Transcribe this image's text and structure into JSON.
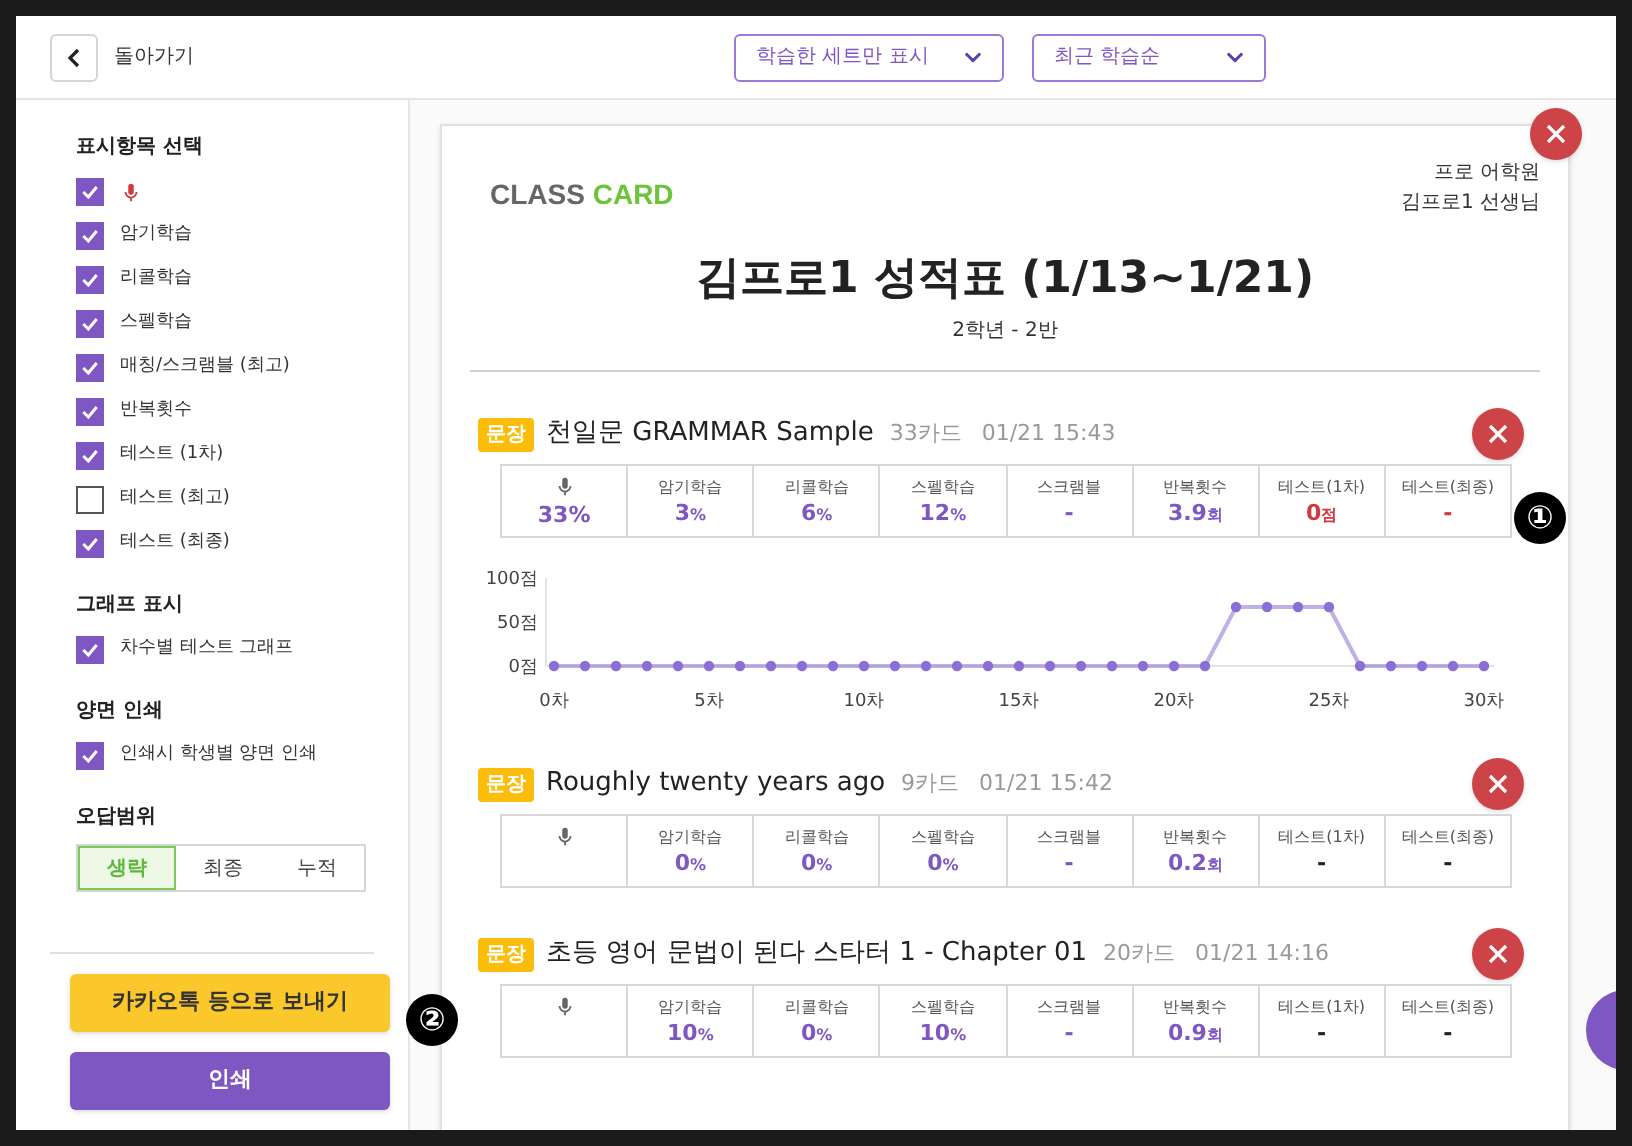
{
  "header": {
    "back_label": "돌아가기",
    "filters": [
      {
        "value": "학습한 세트만 표시"
      },
      {
        "value": "최근 학습순"
      }
    ]
  },
  "sidebar": {
    "sections": [
      {
        "title": "표시항목 선택",
        "items": [
          {
            "kind": "mic",
            "checked": true
          },
          {
            "kind": "text",
            "label": "암기학습",
            "checked": true
          },
          {
            "kind": "text",
            "label": "리콜학습",
            "checked": true
          },
          {
            "kind": "text",
            "label": "스펠학습",
            "checked": true
          },
          {
            "kind": "text",
            "label": "매칭/스크램블 (최고)",
            "checked": true
          },
          {
            "kind": "text",
            "label": "반복횟수",
            "checked": true
          },
          {
            "kind": "text",
            "label": "테스트 (1차)",
            "checked": true
          },
          {
            "kind": "text",
            "label": "테스트 (최고)",
            "checked": false
          },
          {
            "kind": "text",
            "label": "테스트 (최종)",
            "checked": true
          }
        ]
      },
      {
        "title": "그래프 표시",
        "items": [
          {
            "kind": "text",
            "label": "차수별 테스트 그래프",
            "checked": true
          }
        ]
      },
      {
        "title": "양면 인쇄",
        "items": [
          {
            "kind": "text",
            "label": "인쇄시 학생별 양면 인쇄",
            "checked": true
          }
        ]
      }
    ],
    "range": {
      "title": "오답범위",
      "options": [
        {
          "label": "생략",
          "selected": true
        },
        {
          "label": "최종",
          "selected": false
        },
        {
          "label": "누적",
          "selected": false
        }
      ]
    },
    "send_button": "카카오톡 등으로 보내기",
    "print_button": "인쇄"
  },
  "report": {
    "logo": [
      "CLASS",
      "CARD"
    ],
    "academy": "프로 어학원",
    "teacher": "김프로1 선생님",
    "title": "김프로1 성적표 (1/13~1/21)",
    "subtitle": "2학년 - 2반",
    "sets": [
      {
        "tag": "문장",
        "title": "천일문 GRAMMAR Sample",
        "cards": "33카드",
        "date": "01/21 15:43",
        "metrics": [
          {
            "kind": "mic",
            "value": "33%",
            "color": "#7e57c2"
          },
          {
            "kind": "text",
            "label": "암기학습",
            "value": "3",
            "unit": "%",
            "color": "#7e57c2"
          },
          {
            "kind": "text",
            "label": "리콜학습",
            "value": "6",
            "unit": "%",
            "color": "#7e57c2"
          },
          {
            "kind": "text",
            "label": "스펠학습",
            "value": "12",
            "unit": "%",
            "color": "#7e57c2"
          },
          {
            "kind": "text",
            "label": "스크램블",
            "value": "-",
            "color": "#7e57c2"
          },
          {
            "kind": "text",
            "label": "반복횟수",
            "value": "3.9",
            "unit": "회",
            "color": "#7e57c2"
          },
          {
            "kind": "text",
            "label": "테스트(1차)",
            "value": "0",
            "unit": "점",
            "color": "#d0393e"
          },
          {
            "kind": "text",
            "label": "테스트(최종)",
            "value": "-",
            "color": "#d0393e"
          }
        ],
        "chart_data": {
          "type": "line",
          "x": [
            0,
            1,
            2,
            3,
            4,
            5,
            6,
            7,
            8,
            9,
            10,
            11,
            12,
            13,
            14,
            15,
            16,
            17,
            18,
            19,
            20,
            21,
            22,
            23,
            24,
            25,
            26,
            27,
            28,
            29,
            30
          ],
          "series": [
            {
              "color": "#8b6fd6",
              "marker": "circle",
              "values": [
                0,
                0,
                0,
                0,
                0,
                0,
                0,
                0,
                0,
                0,
                0,
                0,
                0,
                0,
                0,
                0,
                0,
                0,
                0,
                0,
                0,
                0,
                67,
                67,
                67,
                67,
                0,
                0,
                0,
                0,
                0
              ]
            }
          ],
          "xticks": [
            {
              "value": 0,
              "label": "0차"
            },
            {
              "value": 5,
              "label": "5차"
            },
            {
              "value": 10,
              "label": "10차"
            },
            {
              "value": 15,
              "label": "15차"
            },
            {
              "value": 20,
              "label": "20차"
            },
            {
              "value": 25,
              "label": "25차"
            },
            {
              "value": 30,
              "label": "30차"
            }
          ],
          "yticks": [
            {
              "value": 0,
              "label": "0점"
            },
            {
              "value": 50,
              "label": "50점"
            },
            {
              "value": 100,
              "label": "100점"
            }
          ],
          "ylim": [
            0,
            100
          ],
          "xlim": [
            0,
            30
          ]
        }
      },
      {
        "tag": "문장",
        "title": "Roughly twenty years ago",
        "cards": "9카드",
        "date": "01/21 15:42",
        "metrics": [
          {
            "kind": "mic"
          },
          {
            "kind": "text",
            "label": "암기학습",
            "value": "0",
            "unit": "%",
            "color": "#7e57c2"
          },
          {
            "kind": "text",
            "label": "리콜학습",
            "value": "0",
            "unit": "%",
            "color": "#7e57c2"
          },
          {
            "kind": "text",
            "label": "스펠학습",
            "value": "0",
            "unit": "%",
            "color": "#7e57c2"
          },
          {
            "kind": "text",
            "label": "스크램블",
            "value": "-",
            "color": "#7e57c2"
          },
          {
            "kind": "text",
            "label": "반복횟수",
            "value": "0.2",
            "unit": "회",
            "color": "#7e57c2"
          },
          {
            "kind": "text",
            "label": "테스트(1차)",
            "value": "-",
            "color": "#222222"
          },
          {
            "kind": "text",
            "label": "테스트(최종)",
            "value": "-",
            "color": "#222222"
          }
        ]
      },
      {
        "tag": "문장",
        "title": "초등 영어 문법이 된다 스타터 1 - Chapter 01",
        "cards": "20카드",
        "date": "01/21 14:16",
        "metrics": [
          {
            "kind": "mic"
          },
          {
            "kind": "text",
            "label": "암기학습",
            "value": "10",
            "unit": "%",
            "color": "#7e57c2"
          },
          {
            "kind": "text",
            "label": "리콜학습",
            "value": "0",
            "unit": "%",
            "color": "#7e57c2"
          },
          {
            "kind": "text",
            "label": "스펠학습",
            "value": "10",
            "unit": "%",
            "color": "#7e57c2"
          },
          {
            "kind": "text",
            "label": "스크램블",
            "value": "-",
            "color": "#7e57c2"
          },
          {
            "kind": "text",
            "label": "반복횟수",
            "value": "0.9",
            "unit": "회",
            "color": "#7e57c2"
          },
          {
            "kind": "text",
            "label": "테스트(1차)",
            "value": "-",
            "color": "#222222"
          },
          {
            "kind": "text",
            "label": "테스트(최종)",
            "value": "-",
            "color": "#222222"
          }
        ]
      }
    ]
  },
  "callouts": [
    "①",
    "②"
  ]
}
